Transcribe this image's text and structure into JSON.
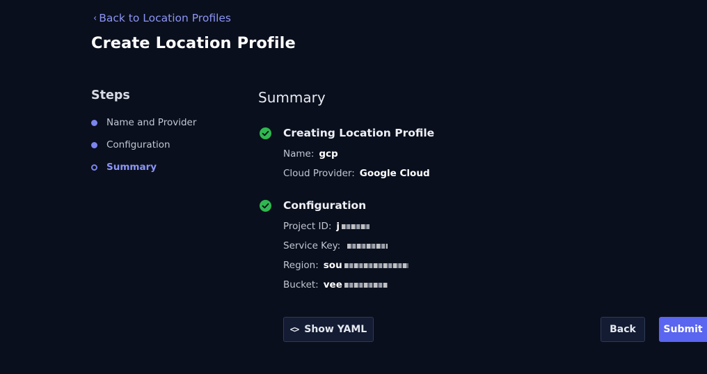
{
  "nav": {
    "back_label": "Back to Location Profiles"
  },
  "page_title": "Create Location Profile",
  "steps": {
    "title": "Steps",
    "items": [
      {
        "label": "Name and Provider",
        "state": "complete"
      },
      {
        "label": "Configuration",
        "state": "complete"
      },
      {
        "label": "Summary",
        "state": "active"
      }
    ]
  },
  "summary": {
    "title": "Summary",
    "sections": [
      {
        "title": "Creating Location Profile",
        "status": "success",
        "fields": [
          {
            "key": "Name:",
            "value": "gcp"
          },
          {
            "key": "Cloud Provider:",
            "value": "Google Cloud"
          }
        ]
      },
      {
        "title": "Configuration",
        "status": "success",
        "fields": [
          {
            "key": "Project ID:",
            "value": "j"
          },
          {
            "key": "Service Key:",
            "value": ""
          },
          {
            "key": "Region:",
            "value": "sou"
          },
          {
            "key": "Bucket:",
            "value": "vee"
          }
        ]
      }
    ]
  },
  "buttons": {
    "show_yaml": "Show YAML",
    "back": "Back",
    "submit": "Submit"
  },
  "colors": {
    "background": "#0a0f1d",
    "accent": "#5a65f0",
    "link": "#8b95f5",
    "success": "#2fb84f"
  },
  "icons": {
    "back": "chevron-left-icon",
    "status": "check-circle-icon",
    "yaml": "code-icon"
  }
}
